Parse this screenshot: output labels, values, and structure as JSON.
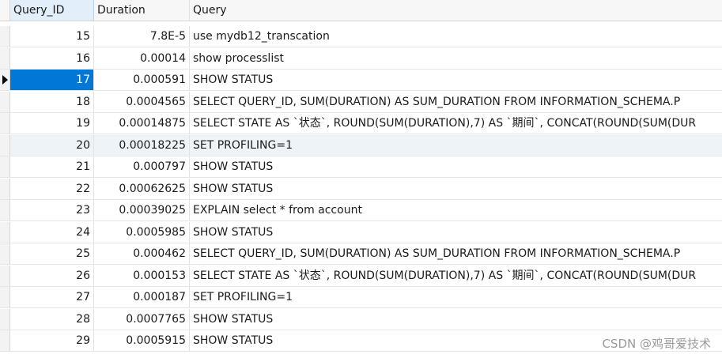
{
  "columns": {
    "id": "Query_ID",
    "duration": "Duration",
    "query": "Query"
  },
  "rows": [
    {
      "id": "15",
      "duration": "7.8E-5",
      "query": "use mydb12_transcation"
    },
    {
      "id": "16",
      "duration": "0.00014",
      "query": "show processlist"
    },
    {
      "id": "17",
      "duration": "0.000591",
      "query": "SHOW STATUS"
    },
    {
      "id": "18",
      "duration": "0.0004565",
      "query": "SELECT QUERY_ID, SUM(DURATION) AS SUM_DURATION FROM INFORMATION_SCHEMA.P"
    },
    {
      "id": "19",
      "duration": "0.00014875",
      "query": "SELECT STATE AS `状态`, ROUND(SUM(DURATION),7) AS `期间`, CONCAT(ROUND(SUM(DUR"
    },
    {
      "id": "20",
      "duration": "0.00018225",
      "query": "SET PROFILING=1"
    },
    {
      "id": "21",
      "duration": "0.000797",
      "query": "SHOW STATUS"
    },
    {
      "id": "22",
      "duration": "0.00062625",
      "query": "SHOW STATUS"
    },
    {
      "id": "23",
      "duration": "0.00039025",
      "query": "EXPLAIN select * from account"
    },
    {
      "id": "24",
      "duration": "0.0005985",
      "query": "SHOW STATUS"
    },
    {
      "id": "25",
      "duration": "0.000462",
      "query": "SELECT QUERY_ID, SUM(DURATION) AS SUM_DURATION FROM INFORMATION_SCHEMA.P"
    },
    {
      "id": "26",
      "duration": "0.000153",
      "query": "SELECT STATE AS `状态`, ROUND(SUM(DURATION),7) AS `期间`, CONCAT(ROUND(SUM(DUR"
    },
    {
      "id": "27",
      "duration": "0.000187",
      "query": "SET PROFILING=1"
    },
    {
      "id": "28",
      "duration": "0.0007765",
      "query": "SHOW STATUS"
    },
    {
      "id": "29",
      "duration": "0.0005915",
      "query": "SHOW STATUS"
    }
  ],
  "selected_row": "17",
  "watermark": "CSDN @鸡哥爱技术",
  "colors": {
    "selection": "#0078d7",
    "header_sorted": "#e2eefa"
  },
  "icons": {
    "row_marker": "current-row-arrow-icon"
  }
}
